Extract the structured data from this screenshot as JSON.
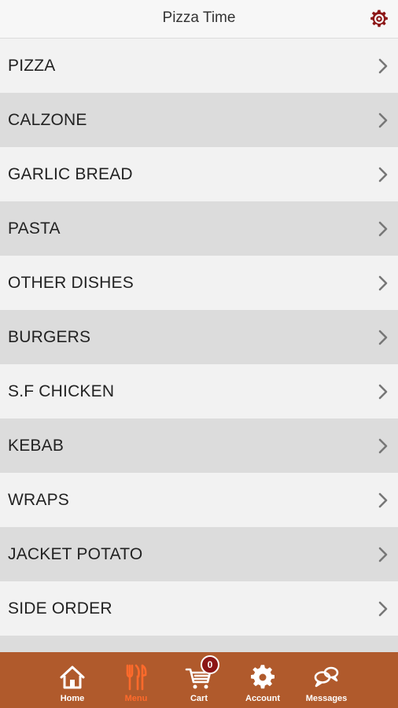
{
  "header": {
    "title": "Pizza Time",
    "settings_icon": "gear-icon",
    "accent_color": "#8c1616"
  },
  "menu": {
    "items": [
      {
        "label": "PIZZA"
      },
      {
        "label": "CALZONE"
      },
      {
        "label": "GARLIC BREAD"
      },
      {
        "label": "PASTA"
      },
      {
        "label": "OTHER DISHES"
      },
      {
        "label": "BURGERS"
      },
      {
        "label": "S.F CHICKEN"
      },
      {
        "label": "KEBAB"
      },
      {
        "label": "WRAPS"
      },
      {
        "label": "JACKET POTATO"
      },
      {
        "label": "SIDE ORDER"
      },
      {
        "label": ""
      }
    ],
    "row_colors": {
      "light": "#f2f2f2",
      "dark": "#dcdcdc"
    }
  },
  "tabbar": {
    "background": "#b05a2c",
    "active_color": "#ff6a2b",
    "tabs": [
      {
        "label": "Home",
        "icon": "home-icon",
        "active": false
      },
      {
        "label": "Menu",
        "icon": "fork-knife-icon",
        "active": true
      },
      {
        "label": "Cart",
        "icon": "cart-icon",
        "active": false,
        "badge": "0"
      },
      {
        "label": "Account",
        "icon": "gear-icon",
        "active": false
      },
      {
        "label": "Messages",
        "icon": "chat-bubbles-icon",
        "active": false
      }
    ]
  }
}
